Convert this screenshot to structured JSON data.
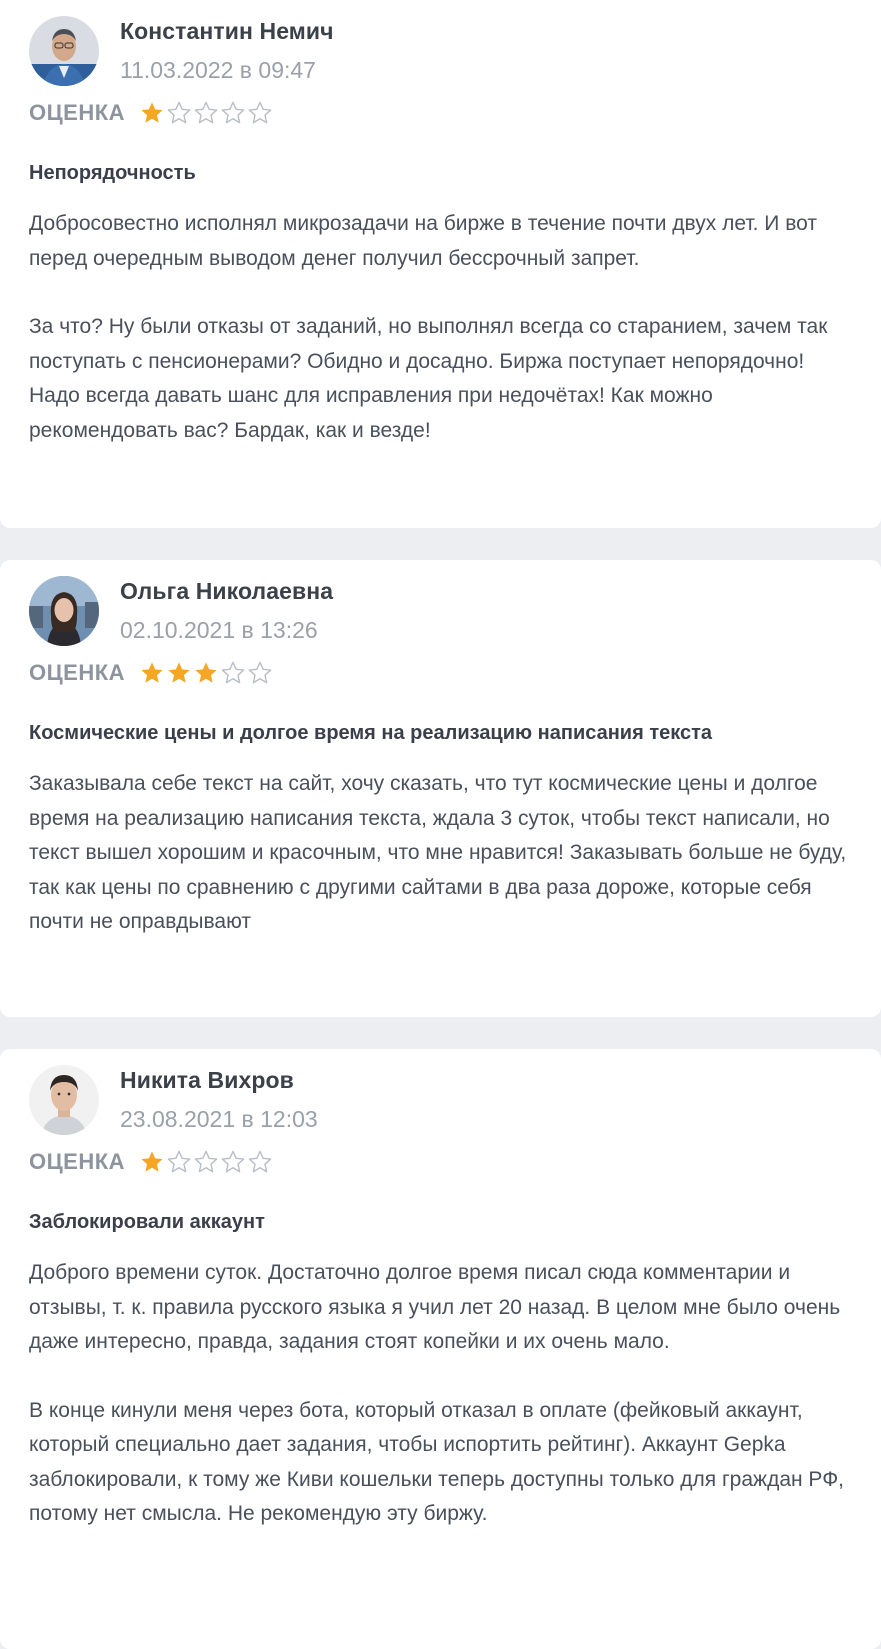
{
  "reviews": [
    {
      "author": "Константин Немич",
      "date": "11.03.2022 в 09:47",
      "rating_label": "ОЦЕНКА",
      "rating": 1,
      "max_rating": 5,
      "title": "Непорядочность",
      "paragraphs": [
        "Добросовестно исполнял микрозадачи на бирже в течение почти двух лет. И вот перед очередным выводом денег получил бессрочный запрет.",
        "За что? Ну были отказы от заданий, но выполнял всегда со старанием, зачем так поступать с пенсионерами? Обидно и досадно. Биржа поступает непорядочно! Надо всегда давать шанс для исправления при недочётах! Как можно рекомендовать вас? Бардак, как и везде!"
      ]
    },
    {
      "author": "Ольга Николаевна",
      "date": "02.10.2021 в 13:26",
      "rating_label": "ОЦЕНКА",
      "rating": 3,
      "max_rating": 5,
      "title": "Космические цены и долгое время на реализацию написания текста",
      "paragraphs": [
        "Заказывала себе текст на сайт, хочу сказать, что тут космические цены и долгое время на реализацию написания текста, ждала 3 суток, чтобы текст написали, но текст вышел хорошим и красочным, что мне нравится! Заказывать больше не буду, так как цены по сравнению с другими сайтами в два раза дороже, которые себя почти не оправдывают"
      ]
    },
    {
      "author": "Никита Вихров",
      "date": "23.08.2021 в 12:03",
      "rating_label": "ОЦЕНКА",
      "rating": 1,
      "max_rating": 5,
      "title": "Заблокировали аккаунт",
      "paragraphs": [
        "Доброго времени суток. Достаточно долгое время писал сюда комментарии и отзывы, т. к. правила русского языка я учил лет 20 назад. В целом мне было очень даже интересно, правда, задания стоят копейки и их очень мало.",
        "В конце кинули меня через бота, который отказал в оплате (фейковый аккаунт, который специально дает задания, чтобы испортить рейтинг). Аккаунт Gepka заблокировали, к тому же Киви кошельки теперь доступны только для граждан РФ, потому нет смысла. Не рекомендую эту биржу."
      ]
    }
  ],
  "colors": {
    "star_filled": "#f5a623",
    "star_empty": "#b9bec6",
    "page_bg": "#eceef1",
    "card_bg": "#ffffff"
  }
}
